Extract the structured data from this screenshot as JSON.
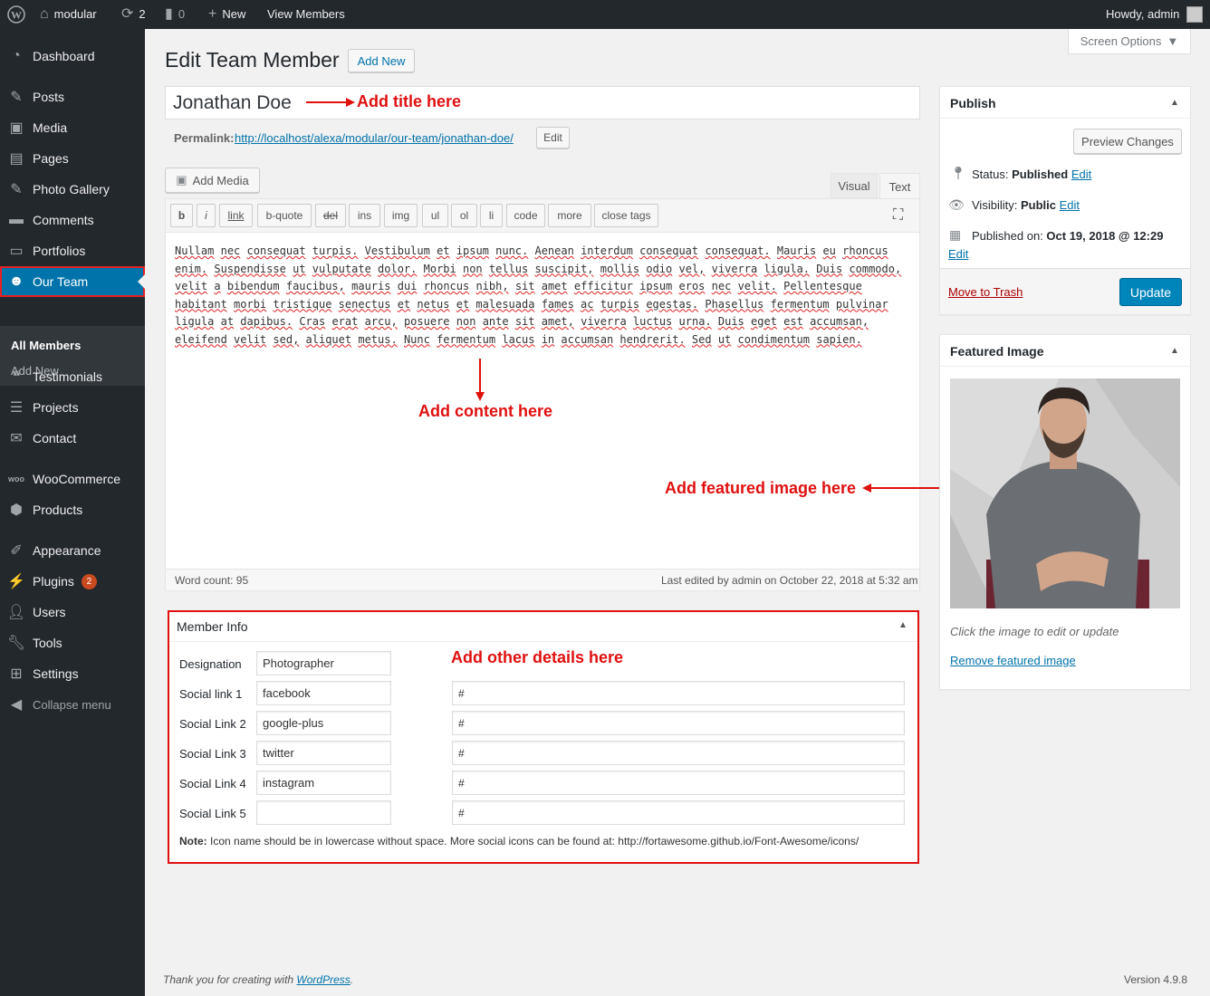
{
  "adminbar": {
    "site": "modular",
    "updates": "2",
    "comments": "0",
    "new": "New",
    "view": "View Members",
    "howdy": "Howdy, admin"
  },
  "menu": {
    "dashboard": "Dashboard",
    "posts": "Posts",
    "media": "Media",
    "pages": "Pages",
    "gallery": "Photo Gallery",
    "comments": "Comments",
    "portfolios": "Portfolios",
    "ourteam": "Our Team",
    "all_members": "All Members",
    "add_new": "Add New",
    "testimonials": "Testimonials",
    "projects": "Projects",
    "contact": "Contact",
    "woo": "WooCommerce",
    "products": "Products",
    "appearance": "Appearance",
    "plugins": "Plugins",
    "plugins_badge": "2",
    "users": "Users",
    "tools": "Tools",
    "settings": "Settings",
    "collapse": "Collapse menu"
  },
  "screen_options": "Screen Options",
  "page_title": "Edit Team Member",
  "add_new_button": "Add New",
  "post_title": "Jonathan Doe",
  "permalink": {
    "label": "Permalink:",
    "url": "http://localhost/alexa/modular/our-team/jonathan-doe/",
    "edit": "Edit"
  },
  "add_media": "Add Media",
  "tabs": {
    "visual": "Visual",
    "text": "Text"
  },
  "quicktags": [
    "b",
    "i",
    "link",
    "b-quote",
    "del",
    "ins",
    "img",
    "ul",
    "ol",
    "li",
    "code",
    "more",
    "close tags"
  ],
  "content": [
    "Nullam",
    "nec",
    "consequat",
    "turpis.",
    "Vestibulum",
    "et",
    "ipsum",
    "nunc.",
    "Aenean",
    "interdum",
    "consequat",
    "consequat.",
    "Mauris",
    "eu",
    "rhoncus",
    "enim.",
    "Suspendisse",
    "ut",
    "vulputate",
    "dolor.",
    "Morbi",
    "non",
    "tellus",
    "suscipit,",
    "mollis",
    "odio",
    "vel,",
    "viverra",
    "ligula.",
    "Duis",
    "commodo,",
    "velit",
    "a",
    "bibendum",
    "faucibus,",
    "mauris",
    "dui",
    "rhoncus",
    "nibh,",
    "sit",
    "amet",
    "efficitur",
    "ipsum",
    "eros",
    "nec",
    "velit.",
    "Pellentesque",
    "habitant",
    "morbi",
    "tristique",
    "senectus",
    "et",
    "netus",
    "et",
    "malesuada",
    "fames",
    "ac",
    "turpis",
    "egestas.",
    "Phasellus",
    "fermentum",
    "pulvinar",
    "ligula",
    "at",
    "dapibus.",
    "Cras",
    "erat",
    "arcu,",
    "posuere",
    "non",
    "ante",
    "sit",
    "amet,",
    "viverra",
    "luctus",
    "urna.",
    "Duis",
    "eget",
    "est",
    "accumsan,",
    "eleifend",
    "velit",
    "sed,",
    "aliquet",
    "metus.",
    "Nunc",
    "fermentum",
    "lacus",
    "in",
    "accumsan",
    "hendrerit.",
    "Sed",
    "ut",
    "condimentum",
    "sapien."
  ],
  "word_count": "Word count: 95",
  "last_edited": "Last edited by admin on October 22, 2018 at 5:32 am",
  "annotations": {
    "title": "Add title here",
    "content": "Add content here",
    "featured": "Add featured image here",
    "details": "Add other details here"
  },
  "member_info": {
    "title": "Member Info",
    "designation_label": "Designation",
    "designation": "Photographer",
    "rows": [
      {
        "label": "Social link 1",
        "icon": "facebook",
        "url": "#"
      },
      {
        "label": "Social Link 2",
        "icon": "google-plus",
        "url": "#"
      },
      {
        "label": "Social Link 3",
        "icon": "twitter",
        "url": "#"
      },
      {
        "label": "Social Link 4",
        "icon": "instagram",
        "url": "#"
      },
      {
        "label": "Social Link 5",
        "icon": "",
        "url": "#"
      }
    ],
    "note_bold": "Note:",
    "note": " Icon name should be in lowercase without space. More social icons can be found at: http://fortawesome.github.io/Font-Awesome/icons/"
  },
  "publish": {
    "title": "Publish",
    "preview": "Preview Changes",
    "status_label": "Status:",
    "status": "Published",
    "visibility_label": "Visibility:",
    "visibility": "Public",
    "published_label": "Published on:",
    "published": "Oct 19, 2018 @ 12:29",
    "edit": "Edit",
    "trash": "Move to Trash",
    "update": "Update"
  },
  "featured": {
    "title": "Featured Image",
    "hint": "Click the image to edit or update",
    "remove": "Remove featured image"
  },
  "footer": {
    "thanks": "Thank you for creating with",
    "wp": "WordPress",
    "version": "Version 4.9.8"
  },
  "colors": {
    "accent": "#0073aa",
    "annotation": "#e01010",
    "adminbar": "#23282d"
  }
}
